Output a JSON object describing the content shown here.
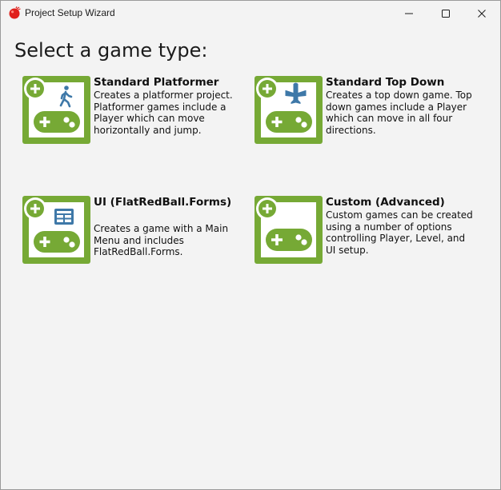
{
  "window": {
    "title": "Project Setup Wizard",
    "icon": "redball-icon",
    "controls": [
      "minimize-icon",
      "maximize-icon",
      "close-icon"
    ]
  },
  "heading": "Select a game type:",
  "colors": {
    "tile_green": "#76a935",
    "tile_inner": "#ffffff",
    "icon_blue": "#3e78a8",
    "background": "#f3f3f3"
  },
  "options": [
    {
      "title": "Standard Platformer",
      "description": "Creates a platformer project. Platformer games include a Player which can move horizontally and jump.",
      "icon": "walking-person-icon"
    },
    {
      "title": "Standard Top Down",
      "description": "Creates a top down game. Top down games include a Player which can move in all four directions.",
      "icon": "airplane-icon"
    },
    {
      "title": "UI (FlatRedBall.Forms)",
      "description": "Creates a game with a Main Menu and includes FlatRedBall.Forms.",
      "icon": "ui-layout-icon"
    },
    {
      "title": "Custom (Advanced)",
      "description": "Custom games can be created using a number of options controlling Player, Level, and UI setup.",
      "icon": ""
    }
  ]
}
